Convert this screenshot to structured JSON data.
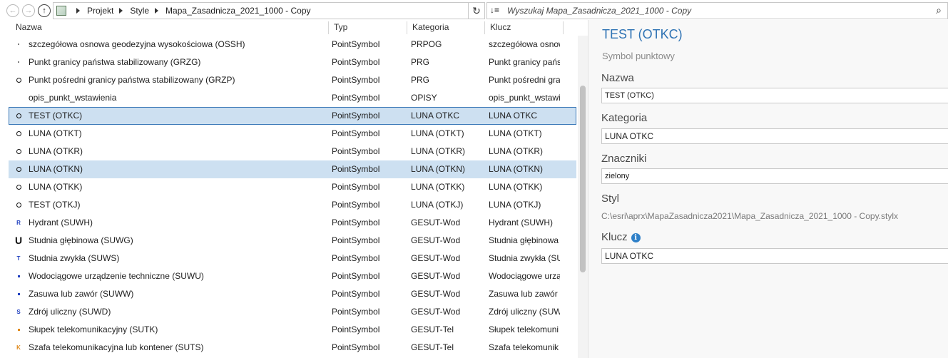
{
  "nav": {
    "back_icon": "←",
    "forward_icon": "→",
    "up_icon": "↑"
  },
  "address": {
    "crumbs": [
      "Projekt",
      "Style",
      "Mapa_Zasadnicza_2021_1000 - Copy"
    ],
    "refresh_icon": "↻"
  },
  "search": {
    "sort_icon": "↓≡",
    "placeholder": "Wyszukaj Mapa_Zasadnicza_2021_1000 - Copy",
    "search_icon": "⌕"
  },
  "list": {
    "headers": {
      "name": "Nazwa",
      "type": "Typ",
      "category": "Kategoria",
      "key": "Klucz"
    },
    "rows": [
      {
        "icon": "dot",
        "name": "szczegółowa osnowa geodezyjna wysokościowa (OSSH)",
        "type": "PointSymbol",
        "category": "PRPOG",
        "key": "szczegółowa osnowa"
      },
      {
        "icon": "dot",
        "name": "Punkt granicy państwa stabilizowany (GRZG)",
        "type": "PointSymbol",
        "category": "PRG",
        "key": "Punkt granicy państ"
      },
      {
        "icon": "ring",
        "name": "Punkt pośredni granicy państwa stabilizowany (GRZP)",
        "type": "PointSymbol",
        "category": "PRG",
        "key": "Punkt pośredni gra"
      },
      {
        "icon": "none",
        "name": "opis_punkt_wstawienia",
        "type": "PointSymbol",
        "category": "OPISY",
        "key": "opis_punkt_wstawi"
      },
      {
        "icon": "ring",
        "name": "TEST (OTKC)",
        "type": "PointSymbol",
        "category": "LUNA OTKC",
        "key": "LUNA OTKC",
        "state": "focus"
      },
      {
        "icon": "ring",
        "name": "LUNA (OTKT)",
        "type": "PointSymbol",
        "category": "LUNA (OTKT)",
        "key": "LUNA (OTKT)"
      },
      {
        "icon": "ring",
        "name": "LUNA (OTKR)",
        "type": "PointSymbol",
        "category": "LUNA (OTKR)",
        "key": "LUNA (OTKR)"
      },
      {
        "icon": "ring",
        "name": "LUNA (OTKN)",
        "type": "PointSymbol",
        "category": "LUNA (OTKN)",
        "key": "LUNA (OTKN)",
        "state": "sel"
      },
      {
        "icon": "ring",
        "name": "LUNA (OTKK)",
        "type": "PointSymbol",
        "category": "LUNA (OTKK)",
        "key": "LUNA (OTKK)"
      },
      {
        "icon": "ring",
        "name": "TEST (OTKJ)",
        "type": "PointSymbol",
        "category": "LUNA (OTKJ)",
        "key": "LUNA (OTKJ)"
      },
      {
        "icon": "letter",
        "glyph": "R",
        "color": "#1f3fbf",
        "name": "Hydrant (SUWH)",
        "type": "PointSymbol",
        "category": "GESUT-Wod",
        "key": "Hydrant (SUWH)"
      },
      {
        "icon": "big",
        "glyph": "U",
        "color": "#111111",
        "name": "Studnia głębinowa (SUWG)",
        "type": "PointSymbol",
        "category": "GESUT-Wod",
        "key": "Studnia głębinowa"
      },
      {
        "icon": "letter",
        "glyph": "T",
        "color": "#1f3fbf",
        "name": "Studnia zwykła (SUWS)",
        "type": "PointSymbol",
        "category": "GESUT-Wod",
        "key": "Studnia zwykła (SU"
      },
      {
        "icon": "sq",
        "color": "#1f3fbf",
        "name": "Wodociągowe urządzenie techniczne (SUWU)",
        "type": "PointSymbol",
        "category": "GESUT-Wod",
        "key": "Wodociągowe urzą"
      },
      {
        "icon": "sq",
        "color": "#1f3fbf",
        "name": "Zasuwa lub zawór (SUWW)",
        "type": "PointSymbol",
        "category": "GESUT-Wod",
        "key": "Zasuwa lub zawór"
      },
      {
        "icon": "letter",
        "glyph": "S",
        "color": "#1f3fbf",
        "name": "Zdrój uliczny (SUWD)",
        "type": "PointSymbol",
        "category": "GESUT-Wod",
        "key": "Zdrój uliczny (SUW"
      },
      {
        "icon": "sq",
        "color": "#e08a1c",
        "name": "Słupek telekomunikacyjny (SUTK)",
        "type": "PointSymbol",
        "category": "GESUT-Tel",
        "key": "Słupek telekomuni"
      },
      {
        "icon": "letter",
        "glyph": "K",
        "color": "#e08a1c",
        "name": "Szafa telekomunikacyjna lub kontener (SUTS)",
        "type": "PointSymbol",
        "category": "GESUT-Tel",
        "key": "Szafa telekomunik"
      }
    ]
  },
  "detail": {
    "title": "TEST (OTKC)",
    "subtitle": "Symbol punktowy",
    "name_label": "Nazwa",
    "name_value": "TEST (OTKC)",
    "category_label": "Kategoria",
    "category_value": "LUNA OTKC",
    "tags_label": "Znaczniki",
    "tags_value": "zielony",
    "style_label": "Styl",
    "style_value": "C:\\esri\\aprx\\MapaZasadnicza2021\\Mapa_Zasadnicza_2021_1000 - Copy.stylx",
    "key_label": "Klucz",
    "key_info_icon": "i",
    "key_value": "LUNA OTKC"
  },
  "colors": {
    "accent": "#2f73b4",
    "selection": "#cde0f1",
    "focus_border": "#3d7ab8"
  }
}
